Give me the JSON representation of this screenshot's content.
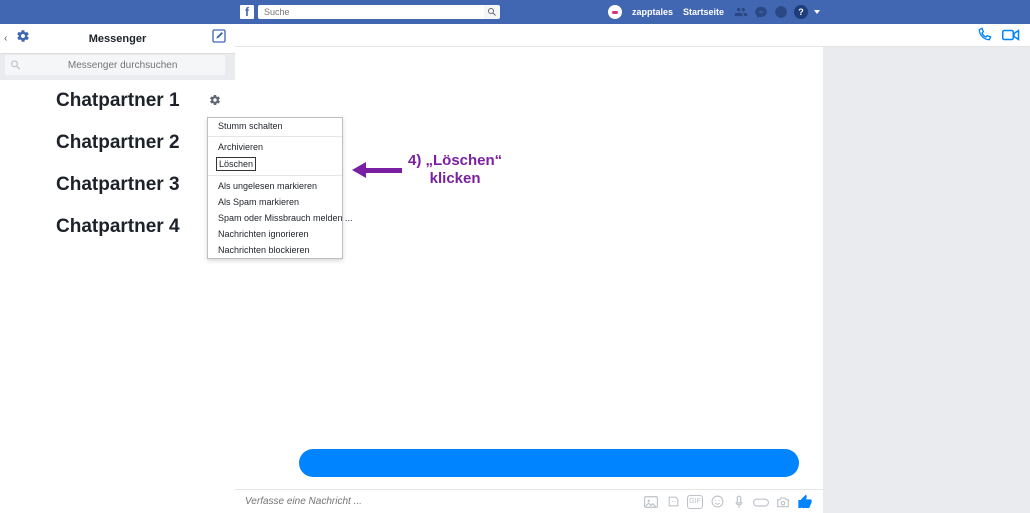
{
  "topbar": {
    "search_placeholder": "Suche",
    "username": "zapptales",
    "home_label": "Startseite"
  },
  "messenger": {
    "title": "Messenger",
    "search_placeholder": "Messenger durchsuchen"
  },
  "sidebar": {
    "items": [
      {
        "label": "Chatpartner 1"
      },
      {
        "label": "Chatpartner 2"
      },
      {
        "label": "Chatpartner 3"
      },
      {
        "label": "Chatpartner 4"
      }
    ]
  },
  "context_menu": {
    "items": [
      "Stumm schalten",
      "Archivieren",
      "Löschen",
      "Als ungelesen markieren",
      "Als Spam markieren",
      "Spam oder Missbrauch melden ...",
      "Nachrichten ignorieren",
      "Nachrichten blockieren"
    ]
  },
  "composer": {
    "placeholder": "Verfasse eine Nachricht ...",
    "gif_label": "GIF"
  },
  "annotation": {
    "text_line1": "4) „Löschen“",
    "text_line2": "klicken"
  }
}
